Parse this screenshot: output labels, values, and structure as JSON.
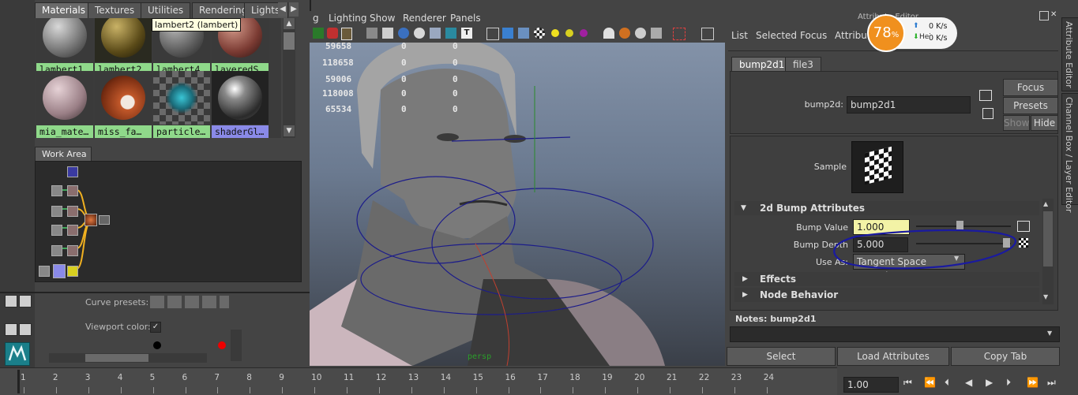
{
  "hypershade": {
    "tabs": [
      "Materials",
      "Textures",
      "Utilities",
      "Rendering",
      "Lights"
    ],
    "tooltip": "lambert2 (lambert)",
    "swatches": [
      {
        "label": "lambert1",
        "selected": false
      },
      {
        "label": "lambert2",
        "selected": false
      },
      {
        "label": "lambert4",
        "selected": false
      },
      {
        "label": "layeredS…",
        "selected": false
      },
      {
        "label": "mia_mate…",
        "selected": false
      },
      {
        "label": "miss_fa…",
        "selected": false
      },
      {
        "label": "particle…",
        "selected": false
      },
      {
        "label": "shaderGl…",
        "selected": true
      }
    ],
    "work_area_label": "Work Area"
  },
  "lower_left": {
    "curve_presets_label": "Curve presets:",
    "viewport_color_label": "Viewport color:"
  },
  "viewport": {
    "menu": [
      "Lighting",
      "Show",
      "Renderer",
      "Panels"
    ],
    "stats": [
      {
        "a": "59658",
        "b": "0",
        "c": "0"
      },
      {
        "a": "118658",
        "b": "0",
        "c": "0"
      },
      {
        "a": "59006",
        "b": "0",
        "c": "0"
      },
      {
        "a": "118008",
        "b": "0",
        "c": "0"
      },
      {
        "a": "65534",
        "b": "0",
        "c": "0"
      }
    ],
    "camera_label": "persp"
  },
  "attribute_editor": {
    "title": "Attribute Editor",
    "menu": [
      "List",
      "Selected",
      "Focus",
      "Attributes"
    ],
    "tabs": [
      "bump2d1",
      "file3"
    ],
    "node_label": "bump2d:",
    "node_value": "bump2d1",
    "focus_button": "Focus",
    "presets_button": "Presets",
    "show_button": "Show",
    "hide_button": "Hide",
    "sample_label": "Sample",
    "section_2d": "2d Bump Attributes",
    "bump_value_label": "Bump Value",
    "bump_value": "1.000",
    "bump_depth_label": "Bump Depth",
    "bump_depth": "5.000",
    "use_as_label": "Use As:",
    "use_as_value": "Tangent Space Normals",
    "section_effects": "Effects",
    "section_node_behavior": "Node Behavior",
    "notes_label": "Notes:  bump2d1",
    "select_button": "Select",
    "load_button": "Load Attributes",
    "copy_button": "Copy Tab"
  },
  "right_tabs": [
    "Attribute Editor",
    "Channel Box / Layer Editor"
  ],
  "perf": {
    "percent": "78",
    "pct_sign": "%",
    "up": "0 K/s",
    "down": "0 K/s",
    "help": "Help"
  },
  "timeline": {
    "ticks": [
      "1",
      "2",
      "3",
      "4",
      "5",
      "6",
      "7",
      "8",
      "9",
      "10",
      "11",
      "12",
      "13",
      "14",
      "15",
      "16",
      "17",
      "18",
      "19",
      "20",
      "21",
      "22",
      "23",
      "24"
    ],
    "current_time": "1.00"
  },
  "colors": {
    "accent_orange": "#f0901e",
    "swatch_green": "#8fd98a",
    "swatch_selected": "#8a8ae8",
    "annotation_blue": "#1a1aa0"
  }
}
